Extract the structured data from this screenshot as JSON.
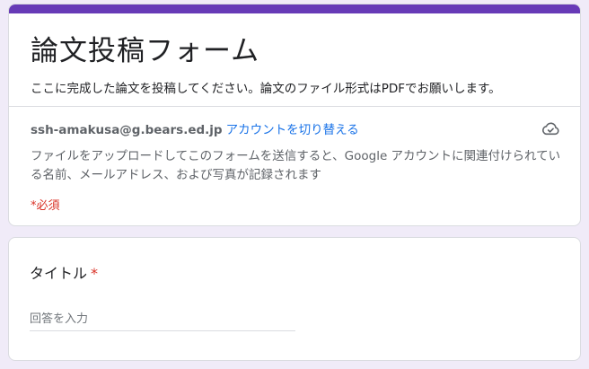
{
  "form": {
    "title": "論文投稿フォーム",
    "description": "ここに完成した論文を投稿してください。論文のファイル形式はPDFでお願いします。",
    "account_email": "ssh-amakusa@g.bears.ed.jp",
    "switch_account_label": "アカウントを切り替える",
    "notice": "ファイルをアップロードしてこのフォームを送信すると、Google アカウントに関連付けられている名前、メールアドレス、および写真が記録されます",
    "required_note": "*必須",
    "cloud_icon": "cloud-check-icon",
    "accent_color": "#673ab7"
  },
  "question": {
    "title": "タイトル",
    "required_mark": "*",
    "placeholder": "回答を入力"
  }
}
